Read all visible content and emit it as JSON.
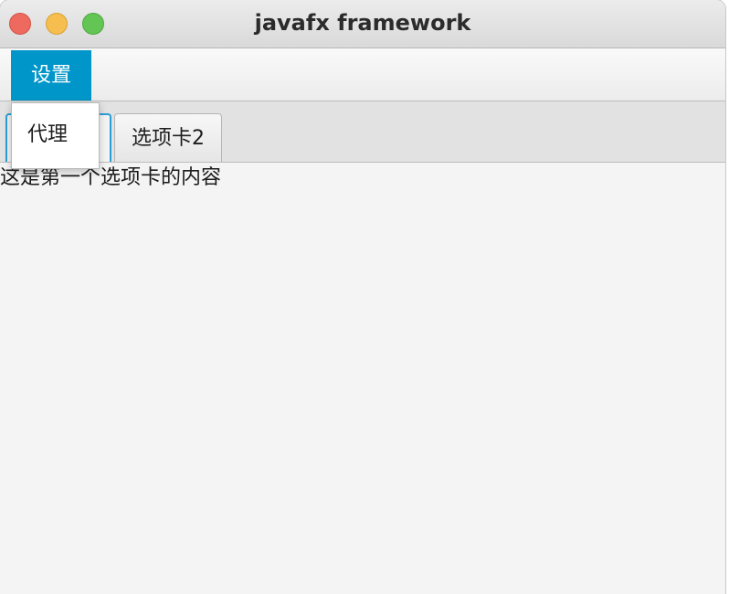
{
  "window": {
    "title": "javafx framework"
  },
  "titlebar": {
    "controls": [
      "close",
      "minimize",
      "maximize"
    ],
    "colors": {
      "close": "#ee6a5f",
      "minimize": "#f5be4f",
      "maximize": "#62c554"
    }
  },
  "menubar": {
    "items": [
      {
        "label": "设置",
        "active": true,
        "accent": "#0096c9"
      }
    ]
  },
  "dropdown": {
    "items": [
      {
        "label": "代理"
      }
    ]
  },
  "tabs": [
    {
      "label": "",
      "selected": true,
      "accent": "#2a9fd6"
    },
    {
      "label": "选项卡2",
      "selected": false
    }
  ],
  "content": {
    "text": "这是第一个选项卡的内容"
  }
}
